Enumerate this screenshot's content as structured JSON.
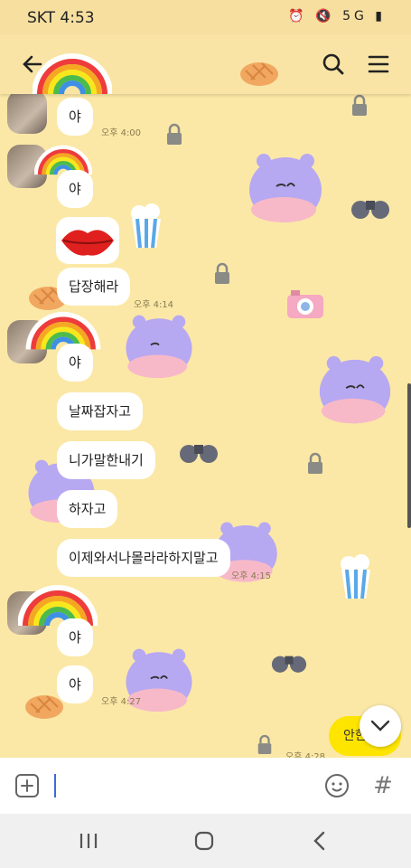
{
  "status": {
    "carrier": "SKT 4:53",
    "icons_text": "⏰ 🔇 5G ▮"
  },
  "header": {
    "back_icon": "arrow-left-icon",
    "search_icon": "search-icon",
    "menu_icon": "hamburger-menu-icon"
  },
  "messages": [
    {
      "text": "야"
    },
    {
      "text": "야"
    },
    {
      "text": "답장해라"
    },
    {
      "text": "야"
    },
    {
      "text": "날짜잡자고"
    },
    {
      "text": "니가말한내기"
    },
    {
      "text": "하자고"
    },
    {
      "text": "이제와서나몰라라하지말고"
    },
    {
      "text": "야"
    },
    {
      "text": "야"
    }
  ],
  "times": [
    "오후 4:00",
    "오후 4:14",
    "오후 4:15",
    "오후 4:27",
    "오후 4:28"
  ],
  "partial_reply": "안한",
  "composer": {
    "add_icon": "plus-square-icon",
    "emoji_icon": "emoji-icon",
    "hash_label": "#"
  },
  "colors": {
    "chat_bg": "#fbe8a6",
    "header_bg": "#f9e4a5",
    "my_bubble": "#fee500"
  }
}
